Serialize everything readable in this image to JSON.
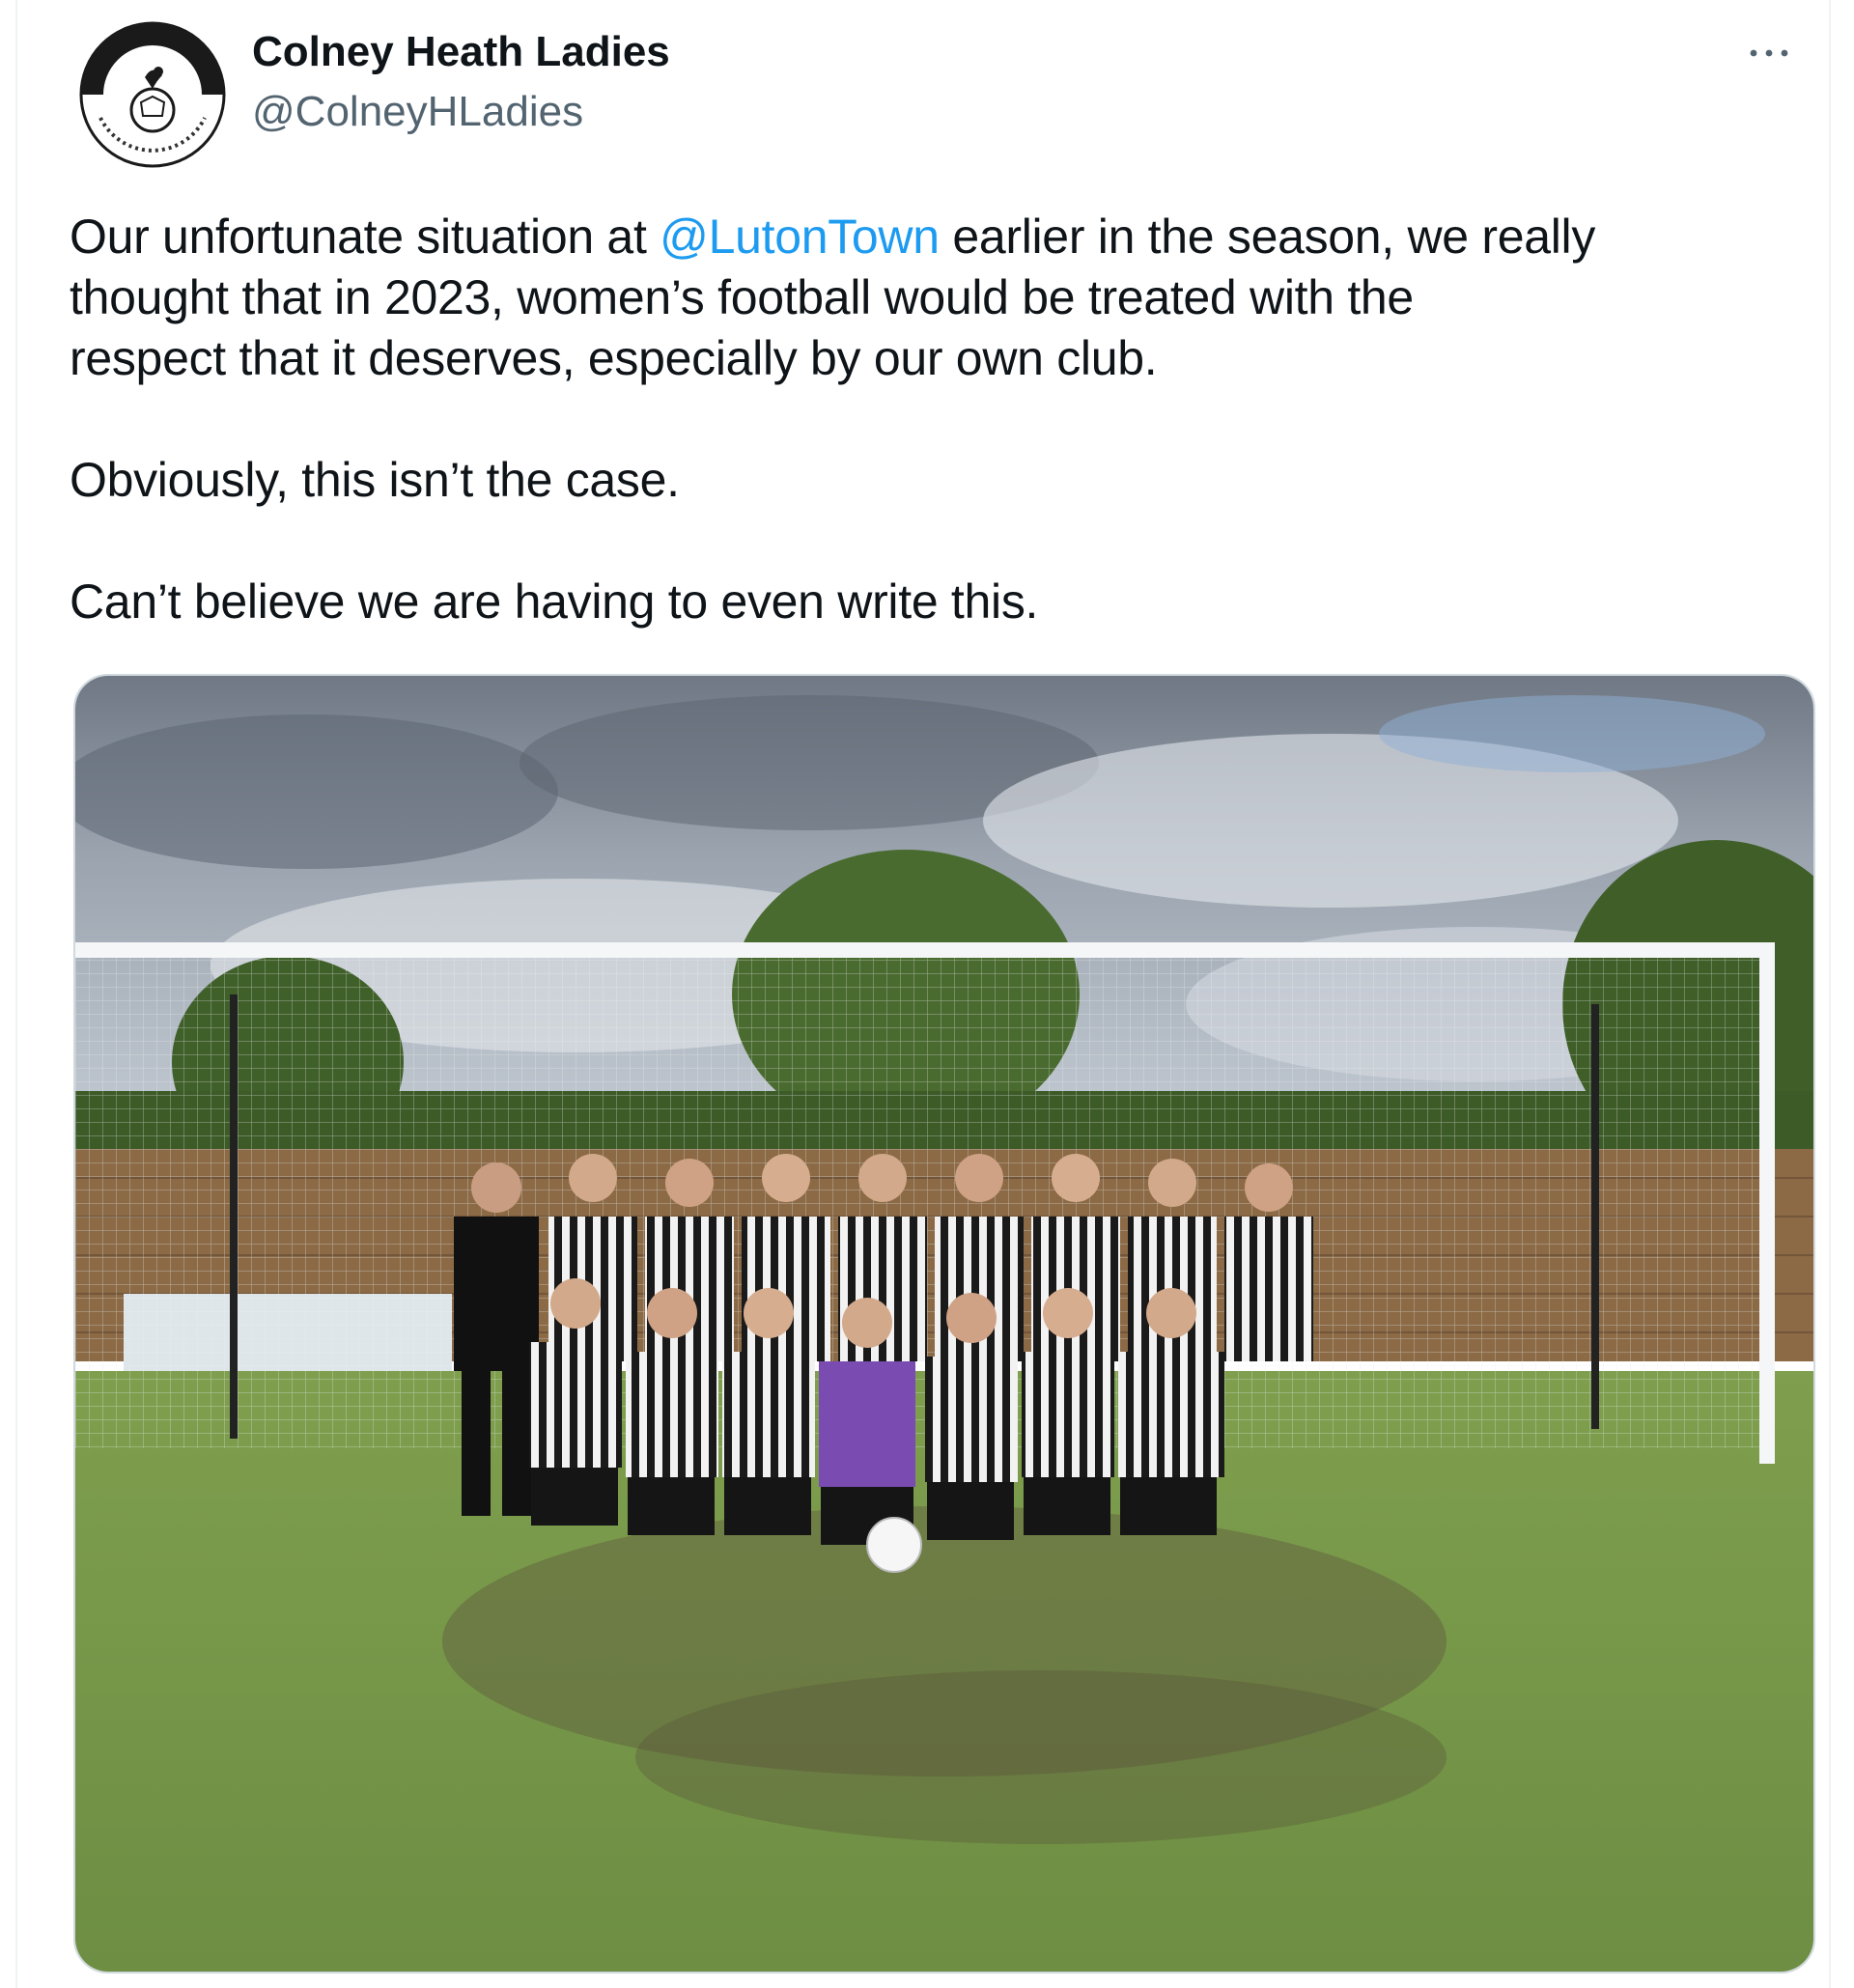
{
  "tweet": {
    "author": {
      "display_name": "Colney Heath Ladies",
      "handle": "@ColneyHLadies",
      "avatar": "club-crest-logo"
    },
    "text": {
      "line1_before_mention": "Our unfortunate situation at ",
      "mention": "@LutonTown",
      "line1_after_mention": " earlier in the season, we really\nthought that in 2023, women’s football would be treated with the\nrespect that it deserves, especially by our own club.",
      "paragraph2": "Obviously, this isn’t the case.",
      "paragraph3": "Can’t believe we are having to even write this."
    },
    "media": {
      "type": "photo",
      "subject": "team-photo-in-front-of-goal"
    },
    "colors": {
      "mention": "#1d9bf0",
      "handle": "#536471",
      "text": "#0f1419",
      "border": "#cfd9de"
    },
    "icons": {
      "more": "more-horizontal-icon"
    }
  }
}
